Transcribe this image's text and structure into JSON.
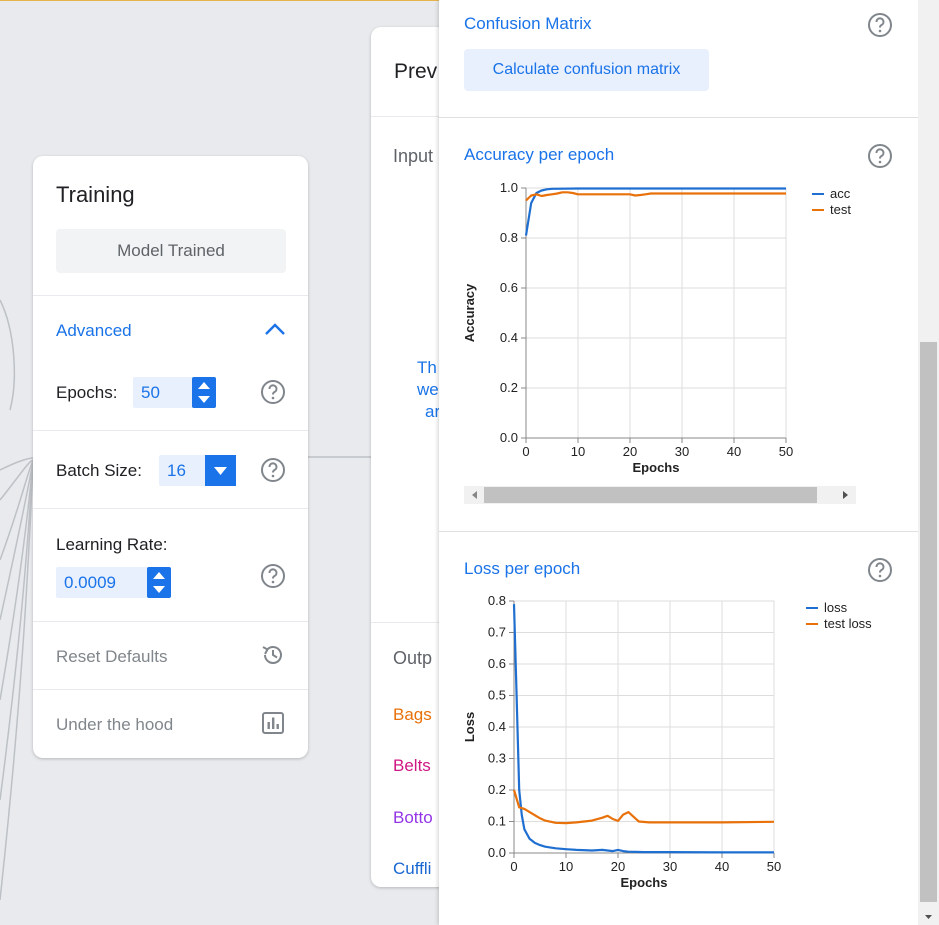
{
  "training": {
    "title": "Training",
    "status_button": "Model Trained",
    "advanced_label": "Advanced",
    "epochs_label": "Epochs:",
    "epochs_value": "50",
    "batch_size_label": "Batch Size:",
    "batch_size_value": "16",
    "learning_rate_label": "Learning Rate:",
    "learning_rate_value": "0.0009",
    "reset_defaults": "Reset Defaults",
    "under_the_hood": "Under the hood"
  },
  "preview": {
    "title": "Prev",
    "input_label": "Input",
    "message_lines": [
      "Th",
      "we",
      "ar"
    ],
    "output_label": "Outp",
    "classes": [
      {
        "label": "Bags",
        "color": "#e8710a"
      },
      {
        "label": "Belts",
        "color": "#d01884"
      },
      {
        "label": "Botto",
        "color": "#9334e6"
      },
      {
        "label": "Cuffli",
        "color": "#1967d2"
      }
    ]
  },
  "panel": {
    "confusion_title": "Confusion Matrix",
    "confusion_button": "Calculate confusion matrix",
    "accuracy_title": "Accuracy per epoch",
    "loss_title": "Loss per epoch"
  },
  "colors": {
    "accent": "#1a73e8",
    "series_train": "#1f6fd1",
    "series_test": "#e8710a"
  },
  "chart_data": [
    {
      "type": "line",
      "title": "Accuracy per epoch",
      "xlabel": "Epochs",
      "ylabel": "Accuracy",
      "xlim": [
        0,
        50
      ],
      "ylim": [
        0,
        1.0
      ],
      "x_ticks": [
        0,
        10,
        20,
        30,
        40,
        50
      ],
      "y_ticks": [
        0.0,
        0.2,
        0.4,
        0.6,
        0.8,
        1.0
      ],
      "grid": true,
      "legend_position": "right",
      "series": [
        {
          "name": "acc",
          "color": "#1f6fd1",
          "x": [
            0,
            1,
            2,
            3,
            4,
            5,
            10,
            20,
            30,
            40,
            50
          ],
          "y": [
            0.81,
            0.94,
            0.98,
            0.99,
            0.995,
            0.997,
            0.998,
            0.998,
            0.998,
            0.998,
            0.998
          ]
        },
        {
          "name": "test",
          "color": "#e8710a",
          "x": [
            0,
            1,
            2,
            3,
            4,
            5,
            6,
            7,
            8,
            9,
            10,
            15,
            20,
            21,
            22,
            23,
            24,
            25,
            30,
            40,
            50
          ],
          "y": [
            0.95,
            0.97,
            0.975,
            0.968,
            0.972,
            0.975,
            0.978,
            0.983,
            0.983,
            0.98,
            0.975,
            0.975,
            0.975,
            0.97,
            0.972,
            0.975,
            0.978,
            0.978,
            0.978,
            0.978,
            0.978
          ]
        }
      ]
    },
    {
      "type": "line",
      "title": "Loss per epoch",
      "xlabel": "Epochs",
      "ylabel": "Loss",
      "xlim": [
        0,
        50
      ],
      "ylim": [
        0,
        0.8
      ],
      "x_ticks": [
        0,
        10,
        20,
        30,
        40,
        50
      ],
      "y_ticks": [
        0.0,
        0.1,
        0.2,
        0.3,
        0.4,
        0.5,
        0.6,
        0.7,
        0.8
      ],
      "grid": true,
      "legend_position": "right",
      "series": [
        {
          "name": "loss",
          "color": "#1f6fd1",
          "x": [
            0,
            0.5,
            1,
            1.5,
            2,
            3,
            4,
            5,
            6,
            8,
            10,
            12,
            15,
            17,
            18,
            19,
            20,
            21,
            22,
            25,
            30,
            40,
            50
          ],
          "y": [
            0.79,
            0.5,
            0.2,
            0.12,
            0.075,
            0.045,
            0.032,
            0.025,
            0.02,
            0.015,
            0.012,
            0.01,
            0.008,
            0.01,
            0.008,
            0.006,
            0.01,
            0.006,
            0.004,
            0.003,
            0.003,
            0.002,
            0.002
          ]
        },
        {
          "name": "test loss",
          "color": "#e8710a",
          "x": [
            0,
            1,
            2,
            3,
            4,
            5,
            6,
            8,
            10,
            12,
            15,
            17,
            18,
            19,
            20,
            21,
            22,
            24,
            26,
            30,
            40,
            50
          ],
          "y": [
            0.2,
            0.145,
            0.14,
            0.13,
            0.12,
            0.11,
            0.103,
            0.096,
            0.095,
            0.097,
            0.103,
            0.112,
            0.118,
            0.108,
            0.102,
            0.122,
            0.13,
            0.1,
            0.097,
            0.097,
            0.097,
            0.099
          ]
        }
      ]
    }
  ]
}
